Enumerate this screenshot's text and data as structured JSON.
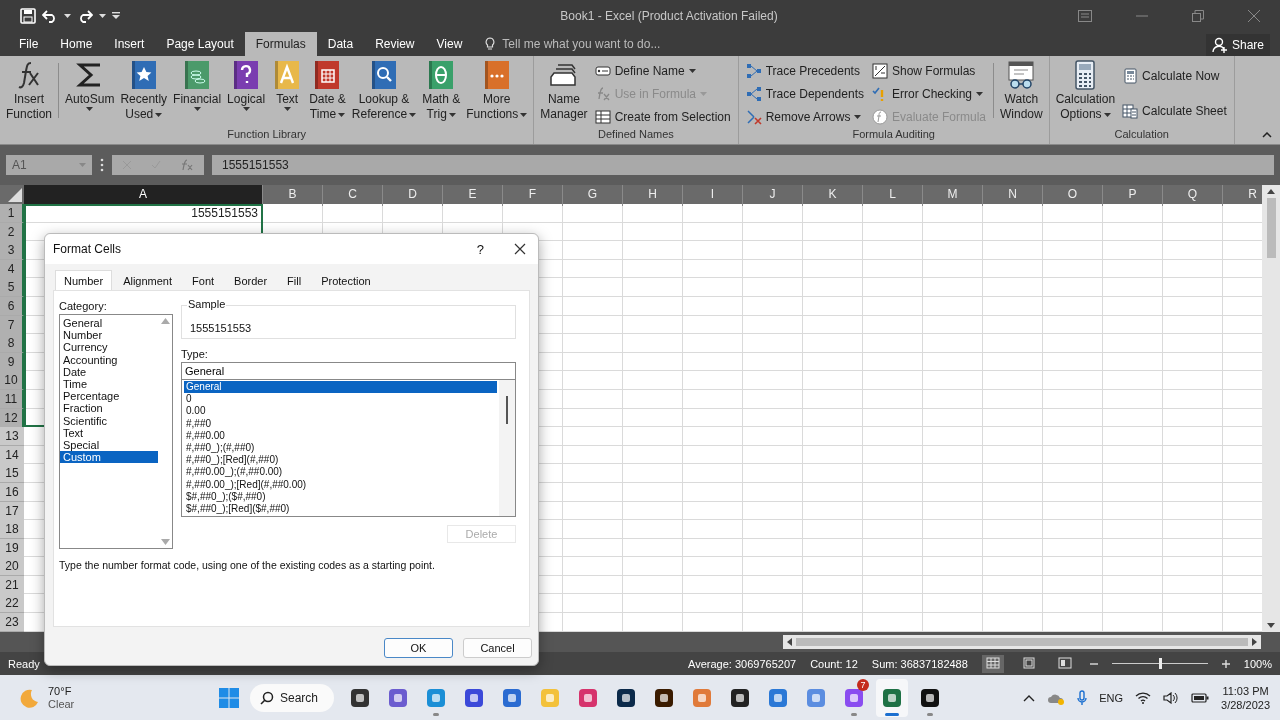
{
  "window": {
    "title": "Book1 - Excel (Product Activation Failed)"
  },
  "ribbon_tabs": [
    {
      "label": "File",
      "selected": false
    },
    {
      "label": "Home",
      "selected": false
    },
    {
      "label": "Insert",
      "selected": false
    },
    {
      "label": "Page Layout",
      "selected": false
    },
    {
      "label": "Formulas",
      "selected": true
    },
    {
      "label": "Data",
      "selected": false
    },
    {
      "label": "Review",
      "selected": false
    },
    {
      "label": "View",
      "selected": false
    }
  ],
  "tell_me": {
    "placeholder": "Tell me what you want to do..."
  },
  "share_button": {
    "label": "Share"
  },
  "ribbon_groups": [
    {
      "label": "Function Library",
      "items": [
        {
          "kind": "large",
          "lines": [
            "Insert",
            "Function"
          ],
          "dropdown": false
        },
        {
          "kind": "separator"
        },
        {
          "kind": "large",
          "lines": [
            "AutoSum"
          ],
          "dropdown": true
        },
        {
          "kind": "large",
          "lines": [
            "Recently",
            "Used"
          ],
          "dropdown": true
        },
        {
          "kind": "large",
          "lines": [
            "Financial"
          ],
          "dropdown": true
        },
        {
          "kind": "large",
          "lines": [
            "Logical"
          ],
          "dropdown": true
        },
        {
          "kind": "large",
          "lines": [
            "Text"
          ],
          "dropdown": true
        },
        {
          "kind": "large",
          "lines": [
            "Date &",
            "Time"
          ],
          "dropdown": true
        },
        {
          "kind": "large",
          "lines": [
            "Lookup &",
            "Reference"
          ],
          "dropdown": true
        },
        {
          "kind": "large",
          "lines": [
            "Math &",
            "Trig"
          ],
          "dropdown": true
        },
        {
          "kind": "large",
          "lines": [
            "More",
            "Functions"
          ],
          "dropdown": true
        }
      ]
    },
    {
      "label": "Defined Names",
      "items": [
        {
          "kind": "large",
          "lines": [
            "Name",
            "Manager"
          ],
          "dropdown": false
        },
        {
          "kind": "stack",
          "items": [
            {
              "label": "Define Name",
              "dropdown": true,
              "disabled": false
            },
            {
              "label": "Use in Formula",
              "dropdown": true,
              "disabled": true
            },
            {
              "label": "Create from Selection",
              "dropdown": false,
              "disabled": false
            }
          ]
        }
      ]
    },
    {
      "label": "Formula Auditing",
      "items": [
        {
          "kind": "stack",
          "items": [
            {
              "label": "Trace Precedents",
              "dropdown": false,
              "disabled": false
            },
            {
              "label": "Trace Dependents",
              "dropdown": false,
              "disabled": false
            },
            {
              "label": "Remove Arrows",
              "dropdown": true,
              "disabled": false
            }
          ]
        },
        {
          "kind": "stack",
          "items": [
            {
              "label": "Show Formulas",
              "dropdown": false,
              "disabled": false
            },
            {
              "label": "Error Checking",
              "dropdown": true,
              "disabled": false
            },
            {
              "label": "Evaluate Formula",
              "dropdown": false,
              "disabled": true
            }
          ]
        },
        {
          "kind": "separator"
        },
        {
          "kind": "large",
          "lines": [
            "Watch",
            "Window"
          ],
          "dropdown": false
        }
      ]
    },
    {
      "label": "Calculation",
      "items": [
        {
          "kind": "large",
          "lines": [
            "Calculation",
            "Options"
          ],
          "dropdown": true
        },
        {
          "kind": "stack",
          "items": [
            {
              "label": "Calculate Now",
              "dropdown": false,
              "disabled": false
            },
            {
              "label": "Calculate Sheet",
              "dropdown": false,
              "disabled": false
            }
          ]
        }
      ]
    }
  ],
  "formula_bar": {
    "name_box": "A1",
    "value": "1555151553"
  },
  "sheet": {
    "columns": [
      {
        "label": "A",
        "selected": true
      },
      {
        "label": "B",
        "selected": false
      },
      {
        "label": "C",
        "selected": false
      },
      {
        "label": "D",
        "selected": false
      },
      {
        "label": "E",
        "selected": false
      },
      {
        "label": "F",
        "selected": false
      },
      {
        "label": "G",
        "selected": false
      },
      {
        "label": "H",
        "selected": false
      },
      {
        "label": "I",
        "selected": false
      },
      {
        "label": "J",
        "selected": false
      },
      {
        "label": "K",
        "selected": false
      },
      {
        "label": "L",
        "selected": false
      },
      {
        "label": "M",
        "selected": false
      },
      {
        "label": "N",
        "selected": false
      },
      {
        "label": "O",
        "selected": false
      },
      {
        "label": "P",
        "selected": false
      },
      {
        "label": "Q",
        "selected": false
      },
      {
        "label": "R",
        "selected": false
      }
    ],
    "rows": [
      {
        "label": "1",
        "selected": true,
        "cells": [
          "1555151553"
        ]
      },
      {
        "label": "2",
        "selected": true
      },
      {
        "label": "3",
        "selected": true
      },
      {
        "label": "4",
        "selected": true
      },
      {
        "label": "5",
        "selected": true
      },
      {
        "label": "6",
        "selected": true
      },
      {
        "label": "7",
        "selected": true
      },
      {
        "label": "8",
        "selected": true
      },
      {
        "label": "9",
        "selected": true
      },
      {
        "label": "10",
        "selected": true
      },
      {
        "label": "11",
        "selected": true
      },
      {
        "label": "12",
        "selected": true
      },
      {
        "label": "13",
        "selected": false
      },
      {
        "label": "14",
        "selected": false
      },
      {
        "label": "15",
        "selected": false
      },
      {
        "label": "16",
        "selected": false
      },
      {
        "label": "17",
        "selected": false
      },
      {
        "label": "18",
        "selected": false
      },
      {
        "label": "19",
        "selected": false
      },
      {
        "label": "20",
        "selected": false
      },
      {
        "label": "21",
        "selected": false
      },
      {
        "label": "22",
        "selected": false
      },
      {
        "label": "23",
        "selected": false
      }
    ]
  },
  "status_bar": {
    "mode": "Ready",
    "average": "Average: 3069765207",
    "count": "Count: 12",
    "sum": "Sum: 36837182488",
    "views": [
      {
        "selected": true
      },
      {
        "selected": false
      },
      {
        "selected": false
      }
    ],
    "zoom": {
      "level": 0.5,
      "label": "100%"
    }
  },
  "dialog": {
    "title": "Format Cells",
    "help_button": "?",
    "tabs": [
      {
        "label": "Number",
        "selected": true
      },
      {
        "label": "Alignment",
        "selected": false
      },
      {
        "label": "Font",
        "selected": false
      },
      {
        "label": "Border",
        "selected": false
      },
      {
        "label": "Fill",
        "selected": false
      },
      {
        "label": "Protection",
        "selected": false
      }
    ],
    "category": {
      "label": "Category:",
      "items": [
        {
          "label": "General",
          "selected": false
        },
        {
          "label": "Number",
          "selected": false
        },
        {
          "label": "Currency",
          "selected": false
        },
        {
          "label": "Accounting",
          "selected": false
        },
        {
          "label": "Date",
          "selected": false
        },
        {
          "label": "Time",
          "selected": false
        },
        {
          "label": "Percentage",
          "selected": false
        },
        {
          "label": "Fraction",
          "selected": false
        },
        {
          "label": "Scientific",
          "selected": false
        },
        {
          "label": "Text",
          "selected": false
        },
        {
          "label": "Special",
          "selected": false
        },
        {
          "label": "Custom",
          "selected": true
        }
      ]
    },
    "sample": {
      "label": "Sample",
      "value": "1555151553"
    },
    "type": {
      "label": "Type:",
      "value": "General",
      "items": [
        {
          "label": "General",
          "selected": true
        },
        {
          "label": "0",
          "selected": false
        },
        {
          "label": "0.00",
          "selected": false
        },
        {
          "label": "#,##0",
          "selected": false
        },
        {
          "label": "#,##0.00",
          "selected": false
        },
        {
          "label": "#,##0_);(#,##0)",
          "selected": false
        },
        {
          "label": "#,##0_);[Red](#,##0)",
          "selected": false
        },
        {
          "label": "#,##0.00_);(#,##0.00)",
          "selected": false
        },
        {
          "label": "#,##0.00_);[Red](#,##0.00)",
          "selected": false
        },
        {
          "label": "$#,##0_);($#,##0)",
          "selected": false
        },
        {
          "label": "$#,##0_);[Red]($#,##0)",
          "selected": false
        }
      ]
    },
    "delete_button": {
      "label": "Delete",
      "disabled": true
    },
    "description": "Type the number format code, using one of the existing codes as a starting point.",
    "buttons": [
      {
        "label": "OK",
        "default": true
      },
      {
        "label": "Cancel",
        "default": false
      }
    ]
  },
  "taskbar": {
    "weather": {
      "temperature": "70°F",
      "condition": "Clear"
    },
    "search": {
      "label": "Search"
    },
    "apps": [
      {
        "selected": false,
        "running": false
      },
      {
        "selected": false,
        "running": false
      },
      {
        "selected": false,
        "running": true
      },
      {
        "selected": false,
        "running": false
      },
      {
        "selected": false,
        "running": false
      },
      {
        "selected": false,
        "running": false
      },
      {
        "selected": false,
        "running": false
      },
      {
        "selected": false,
        "running": false
      },
      {
        "selected": false,
        "running": false
      },
      {
        "selected": false,
        "running": false
      },
      {
        "selected": false,
        "running": false
      },
      {
        "selected": false,
        "running": false
      },
      {
        "selected": false,
        "running": false
      },
      {
        "selected": false,
        "running": true,
        "badge": "7"
      },
      {
        "selected": true,
        "running": true
      },
      {
        "selected": false,
        "running": true
      }
    ],
    "language": "ENG",
    "time": "11:03 PM",
    "date": "3/28/2023"
  }
}
